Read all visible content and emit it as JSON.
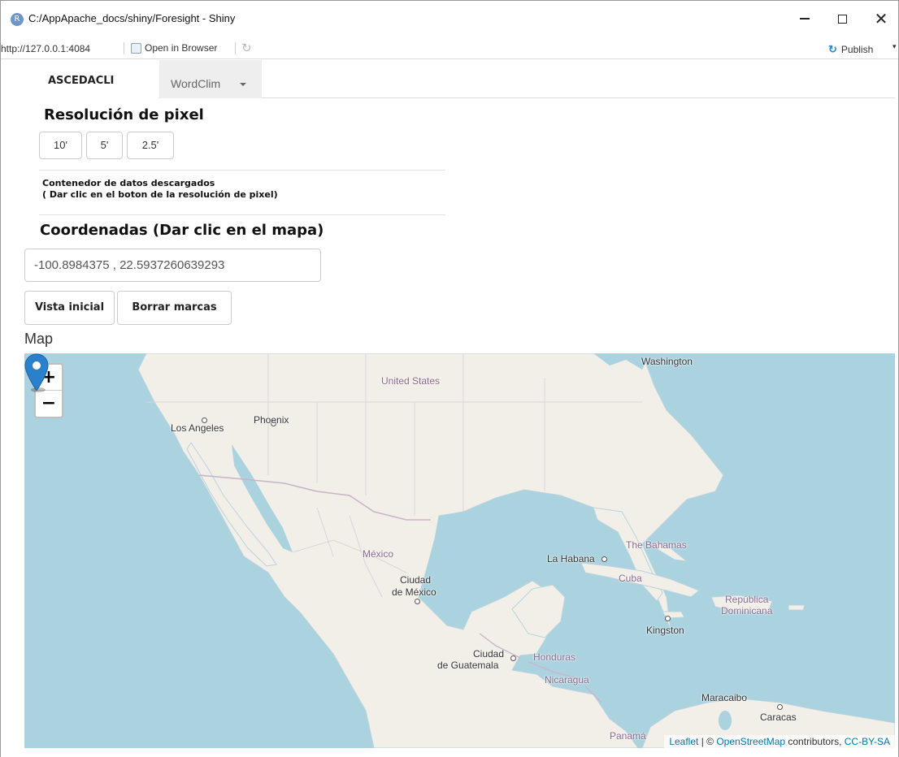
{
  "window": {
    "title": "C:/AppApache_docs/shiny/Foresight - Shiny",
    "logo_letter": "R",
    "minimize_icon": "minimize-icon",
    "maximize_icon": "maximize-icon",
    "close_glyph": "✕"
  },
  "toolbar": {
    "url": "http://127.0.0.1:4084",
    "open_in_browser": "Open in Browser",
    "refresh_glyph": "↻",
    "publish_label": "Publish",
    "publish_glyph": "↻",
    "caret_glyph": "▾"
  },
  "tabs": [
    {
      "label": "ASCEDACLI",
      "active": true
    },
    {
      "label": "WordClim",
      "active": false,
      "dropdown": true
    }
  ],
  "resolution": {
    "heading": "Resolución de pixel",
    "buttons": [
      "10'",
      "5'",
      "2.5'"
    ],
    "note_line1": "Contenedor de datos descargados",
    "note_line2": "( Dar clic en el boton de la resolución de pixel)"
  },
  "coordinates": {
    "heading": "Coordenadas (Dar clic en el mapa)",
    "value": "-100.8984375 , 22.5937260639293"
  },
  "actions": {
    "initial_view": "Vista inicial",
    "clear_marks": "Borrar marcas"
  },
  "map": {
    "label": "Map",
    "zoom_in": "+",
    "zoom_out": "−",
    "marker": {
      "lng": -100.8984375,
      "lat": 22.5937260639293
    },
    "places": {
      "washington": "Washington",
      "united_states": "United States",
      "phoenix": "Phoenix",
      "los_angeles": "Los Angeles",
      "mexico": "México",
      "ciudad_mexico_1": "Ciudad",
      "ciudad_mexico_2": "de México",
      "la_habana": "La Habana",
      "the_bahamas": "The Bahamas",
      "cuba": "Cuba",
      "republica": "República",
      "dominicana": "Dominicana",
      "kingston": "Kingston",
      "ciudad_guatemala_1": "Ciudad",
      "ciudad_guatemala_2": "de Guatemala",
      "honduras": "Honduras",
      "nicaragua": "Nicaragua",
      "maracaibo": "Maracaibo",
      "caracas": "Caracas",
      "panama": "Panamá"
    },
    "attribution": {
      "leaflet": "Leaflet",
      "sep": " | © ",
      "osm": "OpenStreetMap",
      "contributors": " contributors, ",
      "license": "CC-BY-SA"
    },
    "colors": {
      "water": "#aad3df",
      "land": "#f2efe9",
      "border": "#c9b4c9",
      "marker": "#2a81cb"
    }
  }
}
